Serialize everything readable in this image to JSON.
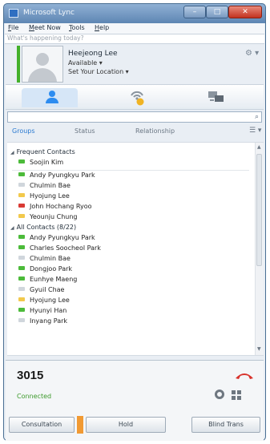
{
  "window": {
    "title": "Microsoft Lync",
    "controls": {
      "minimize": "–",
      "maximize": "□",
      "close": "✕"
    }
  },
  "menu": [
    "File",
    "Meet Now",
    "Tools",
    "Help"
  ],
  "status_message_placeholder": "What's happening today?",
  "user": {
    "name": "Heejeong Lee",
    "availability": "Available ▾",
    "location": "Set Your Location ▾",
    "presence_color": "#43b02a"
  },
  "search": {
    "placeholder": ""
  },
  "filters": [
    "Groups",
    "Status",
    "Relationship"
  ],
  "groups": [
    {
      "name": "Frequent Contacts",
      "contacts": [
        {
          "name": "Soojin Kim",
          "presence": "available"
        },
        {
          "name": "Andy Pyungkyu Park",
          "presence": "available"
        },
        {
          "name": "Chulmin Bae",
          "presence": "offline"
        },
        {
          "name": "Hyojung Lee",
          "presence": "away"
        },
        {
          "name": "John Hochang Ryoo",
          "presence": "busy"
        },
        {
          "name": "Yeounju Chung",
          "presence": "away"
        }
      ]
    },
    {
      "name": "All Contacts (8/22)",
      "contacts": [
        {
          "name": "Andy Pyungkyu Park",
          "presence": "available"
        },
        {
          "name": "Charles Soocheol Park",
          "presence": "available"
        },
        {
          "name": "Chulmin Bae",
          "presence": "offline"
        },
        {
          "name": "Dongjoo Park",
          "presence": "available"
        },
        {
          "name": "Eunhye Maeng",
          "presence": "available"
        },
        {
          "name": "Gyuil Chae",
          "presence": "offline"
        },
        {
          "name": "Hyojung Lee",
          "presence": "away"
        },
        {
          "name": "Hyunyi Han",
          "presence": "available"
        },
        {
          "name": "Inyang Park",
          "presence": "offline"
        }
      ]
    }
  ],
  "presence_colors": {
    "available": "#4cbb3a",
    "offline": "#d0d6dc",
    "away": "#f2c94c",
    "busy": "#d93a34"
  },
  "call": {
    "number": "3015",
    "status": "Connected",
    "buttons": {
      "consultation": "Consultation",
      "hold": "Hold",
      "blind_transfer": "Blind Trans"
    }
  },
  "icons": {
    "contacts_tab": "person-icon",
    "activity_tab": "signal-icon",
    "conversations_tab": "conversation-icon",
    "search": "search-icon",
    "settings": "gear-icon",
    "view_options": "list-icon",
    "hangup": "hangup-icon",
    "dialpad": "dialpad-icon"
  },
  "glyphs": {
    "settings": "⚙ ▾",
    "search": "⌕",
    "view_options": "☰ ▾",
    "expanded": "◢",
    "scroll_up": "▲",
    "scroll_down": "▼"
  }
}
